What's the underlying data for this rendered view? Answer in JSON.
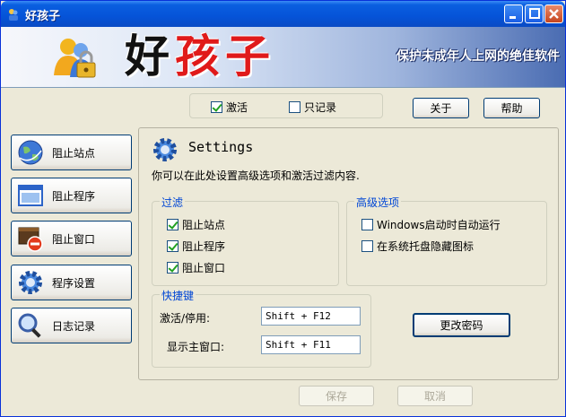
{
  "window": {
    "title": "好孩子"
  },
  "banner": {
    "title_char1": "好",
    "title_rest": "孩子",
    "slogan": "保护未成年人上网的绝佳软件"
  },
  "top_options": {
    "activate_label": "激活",
    "activate_checked": true,
    "log_only_label": "只记录",
    "log_only_checked": false
  },
  "header_buttons": {
    "about": "关于",
    "help": "帮助"
  },
  "sidebar": {
    "items": [
      {
        "label": "阻止站点",
        "icon": "globe-icon"
      },
      {
        "label": "阻止程序",
        "icon": "window-app-icon"
      },
      {
        "label": "阻止窗口",
        "icon": "blocked-window-icon"
      },
      {
        "label": "程序设置",
        "icon": "gear-icon"
      },
      {
        "label": "日志记录",
        "icon": "magnifier-icon"
      }
    ]
  },
  "settings": {
    "heading": "Settings",
    "description": "你可以在此处设置高级选项和激活过滤内容.",
    "filter": {
      "legend": "过滤",
      "items": [
        {
          "label": "阻止站点",
          "checked": true
        },
        {
          "label": "阻止程序",
          "checked": true
        },
        {
          "label": "阻止窗口",
          "checked": true
        }
      ]
    },
    "advanced": {
      "legend": "高级选项",
      "items": [
        {
          "label": "Windows启动时自动运行",
          "checked": false
        },
        {
          "label": "在系统托盘隐藏图标",
          "checked": false
        }
      ]
    },
    "hotkeys": {
      "legend": "快捷键",
      "activate_label": "激活/停用:",
      "activate_value": "Shift + F12",
      "show_label": "显示主窗口:",
      "show_value": "Shift + F11"
    },
    "change_password": "更改密码"
  },
  "footer": {
    "save": "保存",
    "cancel": "取消"
  },
  "colors": {
    "accent_blue": "#0046d5",
    "title_red": "#e01a1a",
    "titlebar": "#0553d8"
  }
}
